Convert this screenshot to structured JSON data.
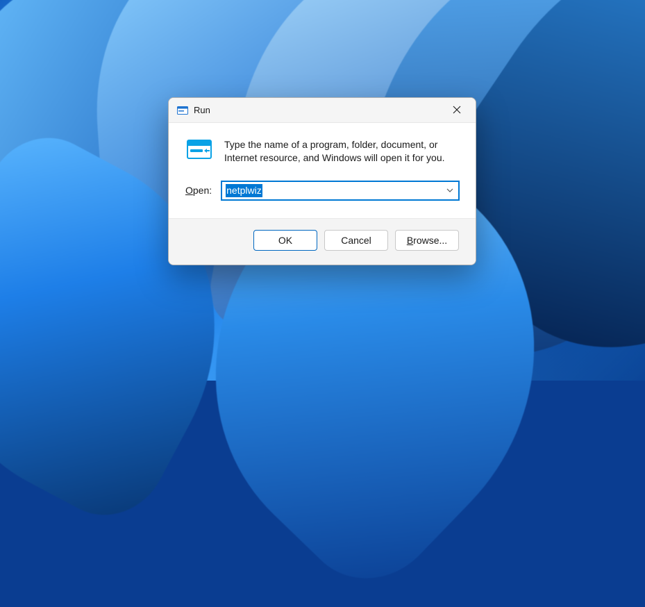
{
  "dialog": {
    "title": "Run",
    "description": "Type the name of a program, folder, document, or Internet resource, and Windows will open it for you.",
    "open_label_pre": "O",
    "open_label_post": "pen:",
    "open_underline": "O",
    "input_value": "netplwiz",
    "buttons": {
      "ok": "OK",
      "cancel": "Cancel",
      "browse_underline": "B",
      "browse_rest": "rowse..."
    }
  },
  "icons": {
    "window": "run-icon",
    "close": "close-icon",
    "chevron": "chevron-down-icon",
    "run_big": "run-dialog-icon"
  }
}
